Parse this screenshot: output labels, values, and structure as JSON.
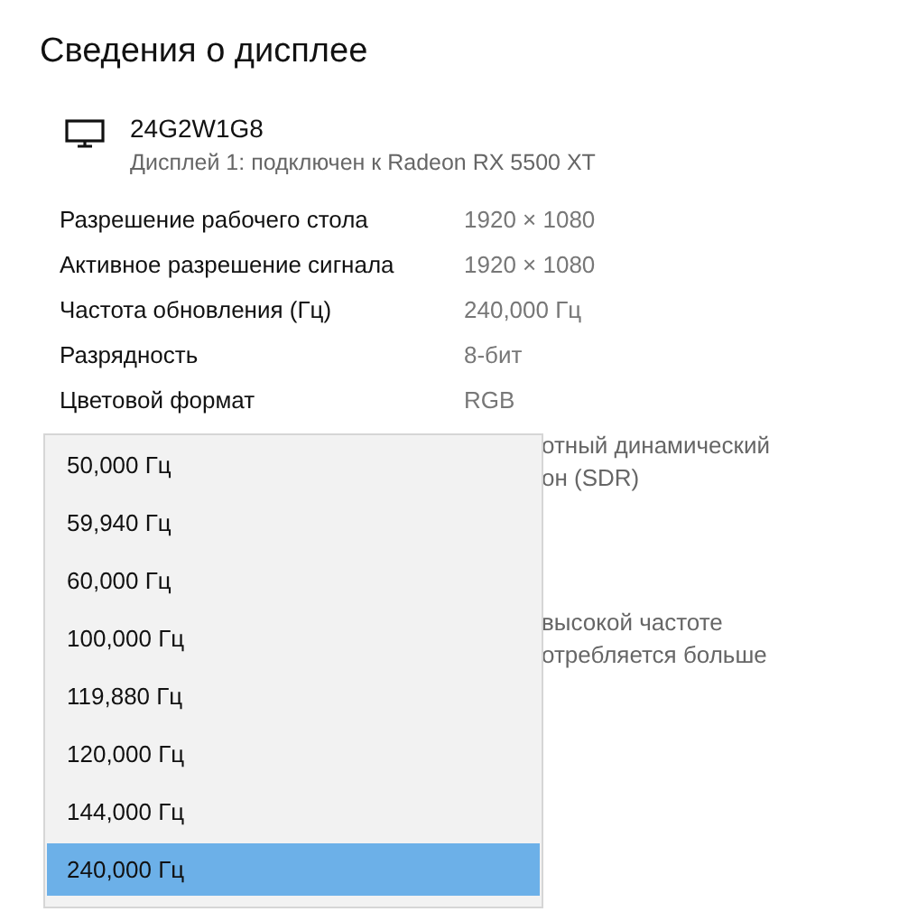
{
  "title": "Сведения о дисплее",
  "display": {
    "name": "24G2W1G8",
    "subtitle": "Дисплей 1: подключен к Radeon RX 5500 XT"
  },
  "properties": [
    {
      "label": "Разрешение рабочего стола",
      "value": "1920 × 1080"
    },
    {
      "label": "Активное разрешение сигнала",
      "value": "1920 × 1080"
    },
    {
      "label": "Частота обновления (Гц)",
      "value": "240,000 Гц"
    },
    {
      "label": "Разрядность",
      "value": "8-бит"
    },
    {
      "label": "Цветовой формат",
      "value": "RGB"
    }
  ],
  "partial_texts": [
    {
      "lines": [
        "отный динамический",
        "он (SDR)"
      ]
    },
    {
      "lines": [
        "высокой частоте",
        "отребляется больше"
      ]
    }
  ],
  "refresh_dropdown": [
    {
      "label": "50,000 Гц",
      "selected": false
    },
    {
      "label": "59,940 Гц",
      "selected": false
    },
    {
      "label": "60,000 Гц",
      "selected": false
    },
    {
      "label": "100,000 Гц",
      "selected": false
    },
    {
      "label": "119,880 Гц",
      "selected": false
    },
    {
      "label": "120,000 Гц",
      "selected": false
    },
    {
      "label": "144,000 Гц",
      "selected": false
    },
    {
      "label": "240,000 Гц",
      "selected": true
    }
  ]
}
